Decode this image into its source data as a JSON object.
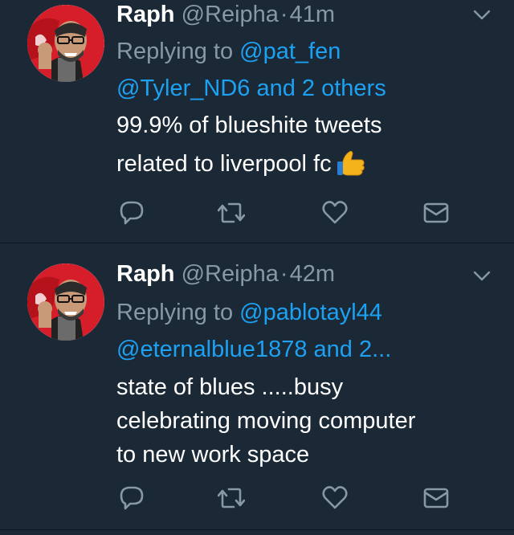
{
  "colors": {
    "background": "#1b2836",
    "muted": "#8899a6",
    "link": "#1da1f2",
    "text": "#ffffff"
  },
  "tweets": [
    {
      "name": "Raph",
      "handle": "@Reipha",
      "dot": "·",
      "time": "41m",
      "replying_prefix": "Replying to",
      "replying_to_line1": "@pat_fen",
      "replying_to_line2": "@Tyler_ND6 and 2 others",
      "text_lines": [
        "99.9% of blueshite tweets",
        "related to liverpool fc"
      ],
      "emoji": "thumbs-up"
    },
    {
      "name": "Raph",
      "handle": "@Reipha",
      "dot": "·",
      "time": "42m",
      "replying_prefix": "Replying to",
      "replying_to_line1": "@pablotayl44",
      "replying_to_line2": "@eternalblue1878 and 2...",
      "text_lines": [
        "state of blues .....busy",
        "celebrating moving computer",
        "to new work space"
      ]
    }
  ],
  "icons": [
    "reply-icon",
    "retweet-icon",
    "like-icon",
    "message-icon",
    "chevron-down-icon"
  ]
}
